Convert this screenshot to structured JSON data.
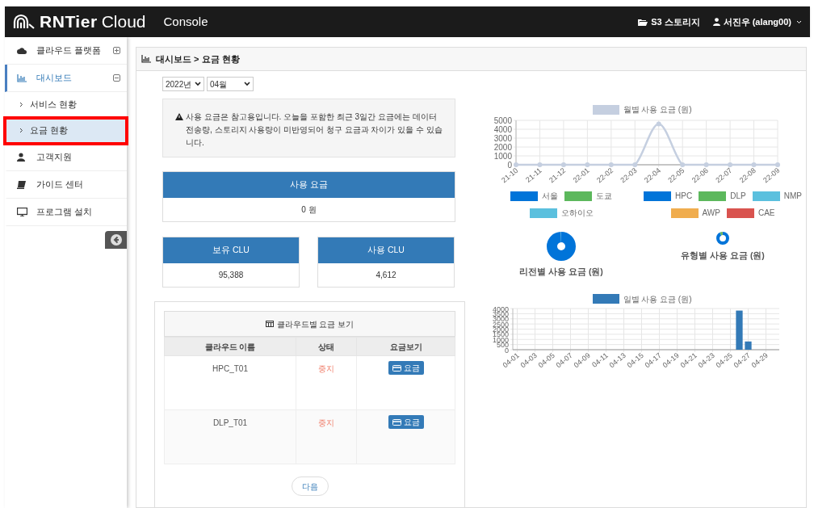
{
  "header": {
    "brand": "RNTier",
    "product": "Cloud",
    "subtitle": "Console",
    "links": [
      {
        "kind": "storage",
        "label": "S3 스토리지"
      },
      {
        "kind": "user",
        "label": "서진우 (alang00)"
      }
    ]
  },
  "sidebar": {
    "items": [
      {
        "kind": "cloud",
        "label": "클라우드 플랫폼",
        "selected": false,
        "expanded": false
      },
      {
        "kind": "dashboard",
        "label": "대시보드",
        "selected": true,
        "expanded": true,
        "children": [
          {
            "label": "서비스 현황",
            "selected": false,
            "highlighted": false
          },
          {
            "label": "요금 현황",
            "selected": true,
            "highlighted": true
          }
        ]
      },
      {
        "kind": "support",
        "label": "고객지원",
        "selected": false
      },
      {
        "kind": "guide",
        "label": "가이드 센터",
        "selected": false
      },
      {
        "kind": "install",
        "label": "프로그램 설치",
        "selected": false
      }
    ]
  },
  "breadcrumb": "대시보드 > 요금 현황",
  "filters": [
    {
      "value": "2022년"
    },
    {
      "value": "04월"
    }
  ],
  "notice": "사용 요금은 참고용입니다. 오늘을 포함한 최근 3일간 요금에는 데이터 전송량, 스토리지 사용량이 미반영되어 청구 요금과 차이가 있을 수 있습니다.",
  "stats": [
    {
      "label": "사용 요금",
      "value": "0 원"
    },
    {
      "label": "보유 CLU",
      "value": "95,388"
    },
    {
      "label": "사용 CLU",
      "value": "4,612"
    }
  ],
  "cloud_table": {
    "title": "클라우드별 요금 보기",
    "columns": [
      "클라우드 이름",
      "상태",
      "요금보기"
    ],
    "rows": [
      {
        "name": "HPC_T01",
        "status": "중지",
        "action": "요금"
      },
      {
        "name": "DLP_T01",
        "status": "중지",
        "action": "요금"
      }
    ],
    "next_button": "다음"
  },
  "monthly_chart": {
    "chart_data": {
      "type": "line",
      "categories": [
        "21-10",
        "21-11",
        "21-12",
        "22-01",
        "22-02",
        "22-03",
        "22-04",
        "22-05",
        "22-06",
        "22-07",
        "22-08",
        "22-09"
      ],
      "series": [
        {
          "name": "월별 사용 요금 (원)",
          "color": "#c5cfe0",
          "marker": true,
          "values": [
            0,
            0,
            0,
            0,
            0,
            0,
            4600,
            0,
            0,
            0,
            0,
            0
          ]
        }
      ],
      "grid": true,
      "ylim": [
        0,
        5000
      ],
      "yticks": [
        0,
        1000,
        2000,
        3000,
        4000,
        5000
      ]
    }
  },
  "region_chart": {
    "title": "리전별 사용 요금 (원)",
    "legend": [
      {
        "label": "서울",
        "color": "#0074d9"
      },
      {
        "label": "도쿄",
        "color": "#5cb85c"
      },
      {
        "label": "오하이오",
        "color": "#5bc0de"
      }
    ]
  },
  "type_chart": {
    "title": "유형별 사용 요금 (원)",
    "legend": [
      {
        "label": "HPC",
        "color": "#0074d9"
      },
      {
        "label": "DLP",
        "color": "#5cb85c"
      },
      {
        "label": "NMP",
        "color": "#5bc0de"
      },
      {
        "label": "AWP",
        "color": "#f0ad4e"
      },
      {
        "label": "CAE",
        "color": "#d9534f"
      }
    ]
  },
  "daily_chart": {
    "chart_data": {
      "type": "bar",
      "categories": [
        "04-01",
        null,
        "04-03",
        null,
        "04-05",
        null,
        "04-07",
        null,
        "04-09",
        null,
        "04-11",
        null,
        "04-13",
        null,
        "04-15",
        null,
        "04-17",
        null,
        "04-19",
        null,
        "04-21",
        null,
        "04-23",
        null,
        "04-25",
        null,
        "04-27",
        null,
        "04-29",
        null
      ],
      "series": [
        {
          "name": "일별 사용 요금 (원)",
          "color": "#337ab7",
          "values": [
            0,
            0,
            0,
            0,
            0,
            0,
            0,
            0,
            0,
            0,
            0,
            0,
            0,
            0,
            0,
            0,
            0,
            0,
            0,
            0,
            0,
            0,
            0,
            0,
            0,
            3800,
            800,
            0,
            0,
            0
          ]
        }
      ],
      "grid": true,
      "ylim": [
        0,
        4000
      ],
      "yticks": [
        0,
        500,
        1000,
        1500,
        2000,
        2500,
        3000,
        3500,
        4000
      ]
    }
  }
}
